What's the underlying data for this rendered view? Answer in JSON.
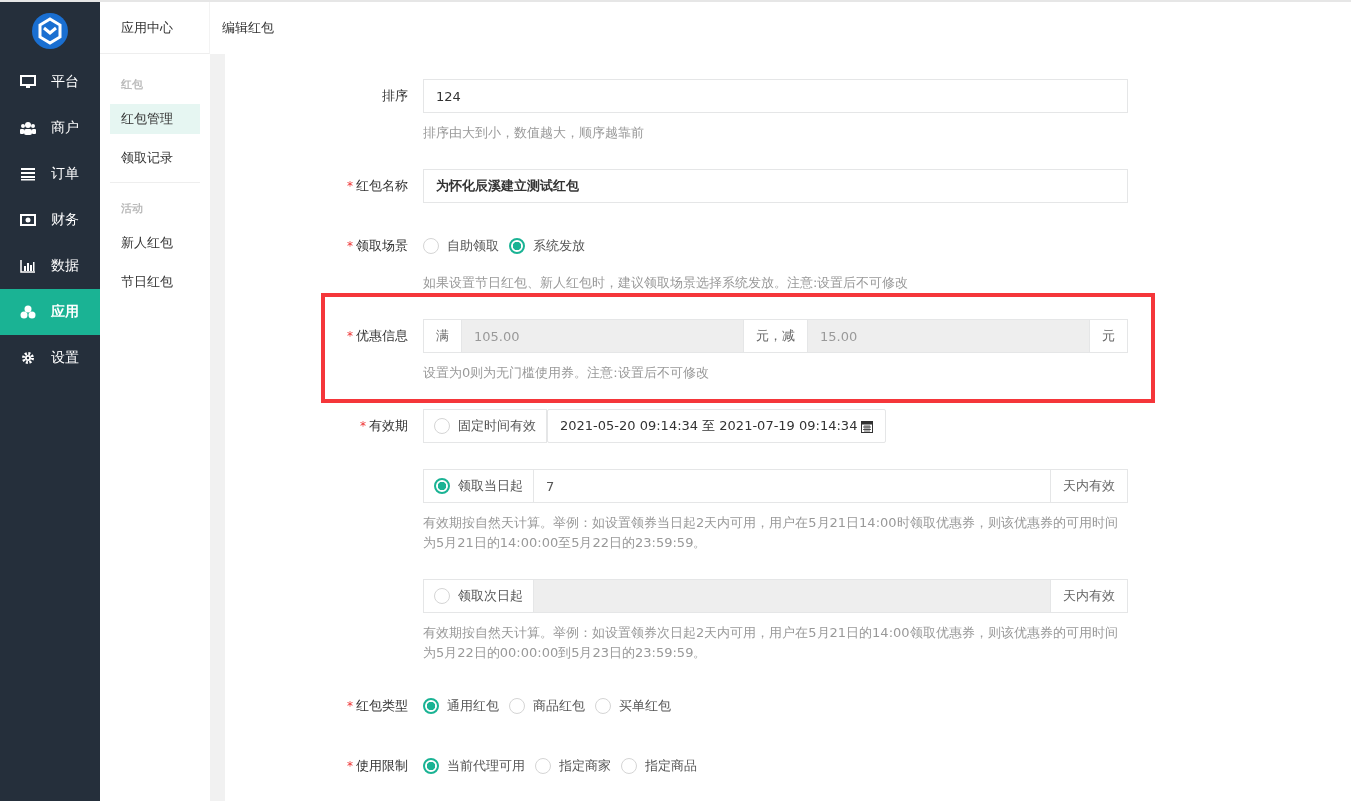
{
  "sidebar": {
    "items": [
      {
        "label": "平台",
        "selected": false
      },
      {
        "label": "商户",
        "selected": false
      },
      {
        "label": "订单",
        "selected": false
      },
      {
        "label": "财务",
        "selected": false
      },
      {
        "label": "数据",
        "selected": false
      },
      {
        "label": "应用",
        "selected": true
      },
      {
        "label": "设置",
        "selected": false
      }
    ]
  },
  "subnav": {
    "title": "应用中心",
    "groups": [
      {
        "heading": "红包",
        "items": [
          {
            "label": "红包管理",
            "selected": true
          },
          {
            "label": "领取记录",
            "selected": false
          }
        ]
      },
      {
        "heading": "活动",
        "items": [
          {
            "label": "新人红包",
            "selected": false
          },
          {
            "label": "节日红包",
            "selected": false
          }
        ]
      }
    ]
  },
  "page": {
    "title": "编辑红包"
  },
  "form": {
    "fields": [
      {
        "kind": "text",
        "label": "排序",
        "value": "124",
        "bold": false,
        "help": "排序由大到小，数值越大，顺序越靠前"
      },
      {
        "kind": "text",
        "label": "红包名称",
        "required_mark": "*",
        "value": "为怀化辰溪建立测试红包",
        "bold": true
      },
      {
        "kind": "radio",
        "label": "领取场景",
        "required_mark": "*",
        "options": [
          {
            "label": "自助领取",
            "selected": false
          },
          {
            "label": "系统发放",
            "selected": true
          }
        ],
        "help": "如果设置节日红包、新人红包时，建议领取场景选择系统发放。注意:设置后不可修改"
      },
      {
        "kind": "discount",
        "label": "优惠信息",
        "required_mark": "*",
        "highlighted": true,
        "disabled": true,
        "prefix": "满",
        "threshold": "105.00",
        "middle": "元，减",
        "amount": "15.00",
        "suffix": "元",
        "help": "设置为0则为无门槛使用券。注意:设置后不可修改"
      },
      {
        "kind": "validity",
        "label": "有效期",
        "required_mark": "*",
        "options": [
          {
            "kind": "range",
            "label": "固定时间有效",
            "selected": false,
            "value": "2021-05-20 09:14:34 至 2021-07-19 09:14:34"
          },
          {
            "kind": "days",
            "label": "领取当日起",
            "selected": true,
            "disabled": false,
            "value": "7",
            "suffix": "天内有效",
            "help": "有效期按自然天计算。举例：如设置领券当日起2天内可用，用户在5月21日14:00时领取优惠券，则该优惠券的可用时间为5月21日的14:00:00至5月22日的23:59:59。"
          },
          {
            "kind": "days",
            "label": "领取次日起",
            "selected": false,
            "disabled": true,
            "suffix": "天内有效",
            "help": "有效期按自然天计算。举例：如设置领券次日起2天内可用，用户在5月21日的14:00领取优惠券，则该优惠券的可用时间为5月22日的00:00:00到5月23日的23:59:59。"
          }
        ]
      },
      {
        "kind": "radio",
        "label": "红包类型",
        "required_mark": "*",
        "options": [
          {
            "label": "通用红包",
            "selected": true
          },
          {
            "label": "商品红包",
            "selected": false
          },
          {
            "label": "买单红包",
            "selected": false
          }
        ]
      },
      {
        "kind": "radio",
        "label": "使用限制",
        "required_mark": "*",
        "options": [
          {
            "label": "当前代理可用",
            "selected": true
          },
          {
            "label": "指定商家",
            "selected": false
          },
          {
            "label": "指定商品",
            "selected": false
          }
        ]
      }
    ]
  }
}
